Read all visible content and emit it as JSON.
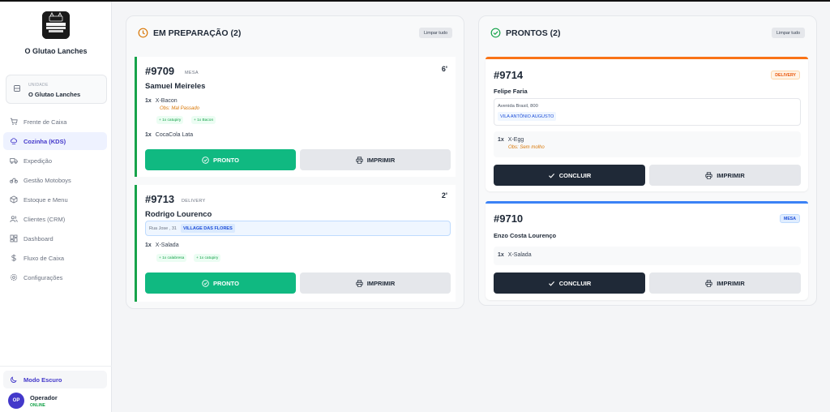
{
  "brand": {
    "name": "O Glutao Lanches"
  },
  "unit": {
    "label": "UNIDADE",
    "value": "O Glutao Lanches"
  },
  "nav": [
    {
      "label": "Frente de Caixa",
      "icon": "cart-icon"
    },
    {
      "label": "Cozinha (KDS)",
      "icon": "chef-hat-icon",
      "active": true
    },
    {
      "label": "Expedição",
      "icon": "truck-icon"
    },
    {
      "label": "Gestão Motoboys",
      "icon": "bike-icon"
    },
    {
      "label": "Estoque e Menu",
      "icon": "box-icon"
    },
    {
      "label": "Clientes (CRM)",
      "icon": "users-icon"
    },
    {
      "label": "Dashboard",
      "icon": "dashboard-icon"
    },
    {
      "label": "Fluxo de Caixa",
      "icon": "dollar-icon"
    },
    {
      "label": "Configurações",
      "icon": "gear-icon"
    }
  ],
  "dark_mode": {
    "label": "Modo Escuro"
  },
  "operator": {
    "initials": "OP",
    "name": "Operador",
    "status": "ONLINE"
  },
  "prep": {
    "title": "EM PREPARAÇÃO (2)",
    "clear": "Limpar tudo",
    "orders": [
      {
        "number": "#9709",
        "type": "MESA",
        "timer": "6'",
        "customer": "Samuel Meireles",
        "items": [
          {
            "qty": "1x",
            "name": "X-Bacon",
            "obs": "Obs: Mal Passado",
            "extras": [
              "+ 1x catupiry",
              "+ 1x Bacon"
            ]
          },
          {
            "qty": "1x",
            "name": "CocaCola Lata"
          }
        ],
        "ready": "PRONTO",
        "print": "IMPRIMIR"
      },
      {
        "number": "#9713",
        "type": "DELIVERY",
        "timer": "2'",
        "customer": "Rodrigo Lourenco",
        "address": "Rua Jose , 31",
        "neighborhood": "VILLAGE DAS FLORES",
        "items": [
          {
            "qty": "1x",
            "name": "X-Salada",
            "extras": [
              "+ 1x calabresa",
              "+ 1x catupiry"
            ]
          }
        ],
        "ready": "PRONTO",
        "print": "IMPRIMIR"
      }
    ]
  },
  "ready": {
    "title": "PRONTOS (2)",
    "clear": "Limpar tudo",
    "orders": [
      {
        "number": "#9714",
        "type": "DELIVERY",
        "customer": "Felipe Faria",
        "address": "Avenida Brasil, 800",
        "neighborhood": "VILA ANTÔNIO AUGUSTO",
        "items": [
          {
            "qty": "1x",
            "name": "X-Egg",
            "obs": "Obs: Sem molho"
          }
        ],
        "done": "CONCLUIR",
        "print": "IMPRIMIR",
        "accent": "#f97316"
      },
      {
        "number": "#9710",
        "type": "MESA",
        "customer": "Enzo Costa Lourenço",
        "items": [
          {
            "qty": "1x",
            "name": "X-Salada"
          }
        ],
        "done": "CONCLUIR",
        "print": "IMPRIMIR",
        "accent": "#3b82f6"
      }
    ]
  },
  "colors": {
    "primary": "#4338ca",
    "ready_green": "#10b981",
    "dark": "#1f2937",
    "delivery": "#f97316",
    "mesa": "#3b82f6"
  }
}
